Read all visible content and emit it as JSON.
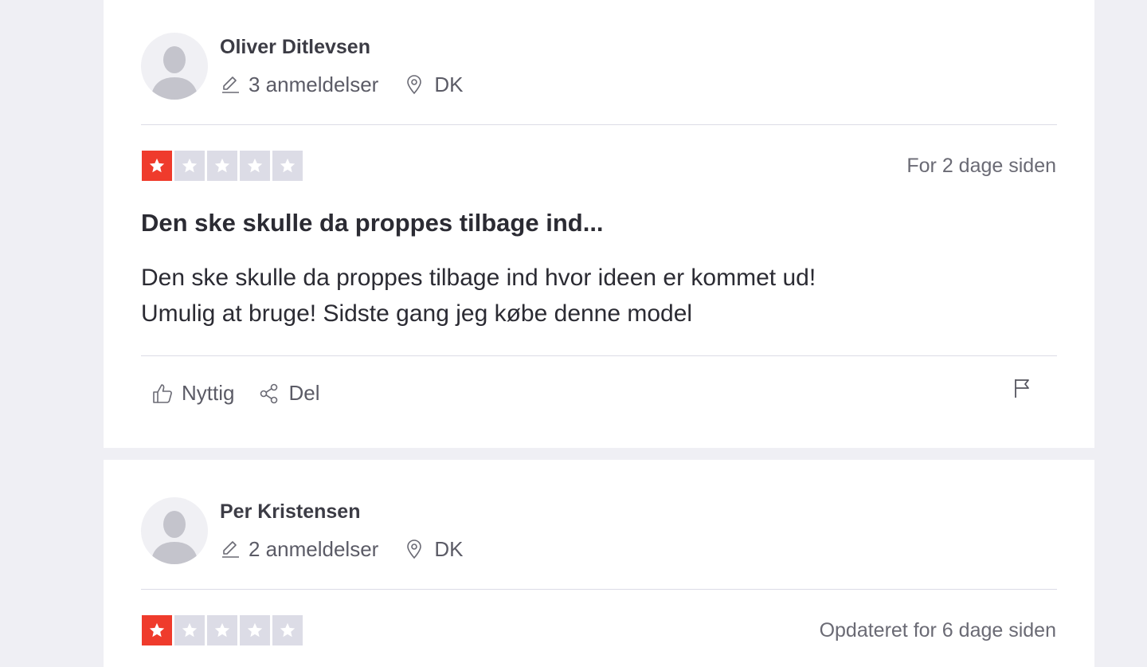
{
  "reviews": [
    {
      "author": "Oliver Ditlevsen",
      "review_count": "3 anmeldelser",
      "country": "DK",
      "rating": 1,
      "date": "For 2 dage siden",
      "title": "Den ske skulle da proppes tilbage ind...",
      "body_line1": "Den ske skulle da proppes tilbage ind hvor ideen er kommet ud!",
      "body_line2": "Umulig at bruge! Sidste gang jeg købe denne model",
      "useful_label": "Nyttig",
      "share_label": "Del"
    },
    {
      "author": "Per Kristensen",
      "review_count": "2 anmeldelser",
      "country": "DK",
      "rating": 1,
      "date": "Opdateret for 6 dage siden"
    }
  ],
  "colors": {
    "star_active": "#ef3b2c",
    "star_inactive": "#dcdce6",
    "page_bg": "#efeff4"
  },
  "icons": {
    "avatar": "user-silhouette-icon",
    "reviews": "pencil-icon",
    "location": "location-pin-icon",
    "useful": "thumbs-up-icon",
    "share": "share-icon",
    "report": "flag-icon"
  }
}
